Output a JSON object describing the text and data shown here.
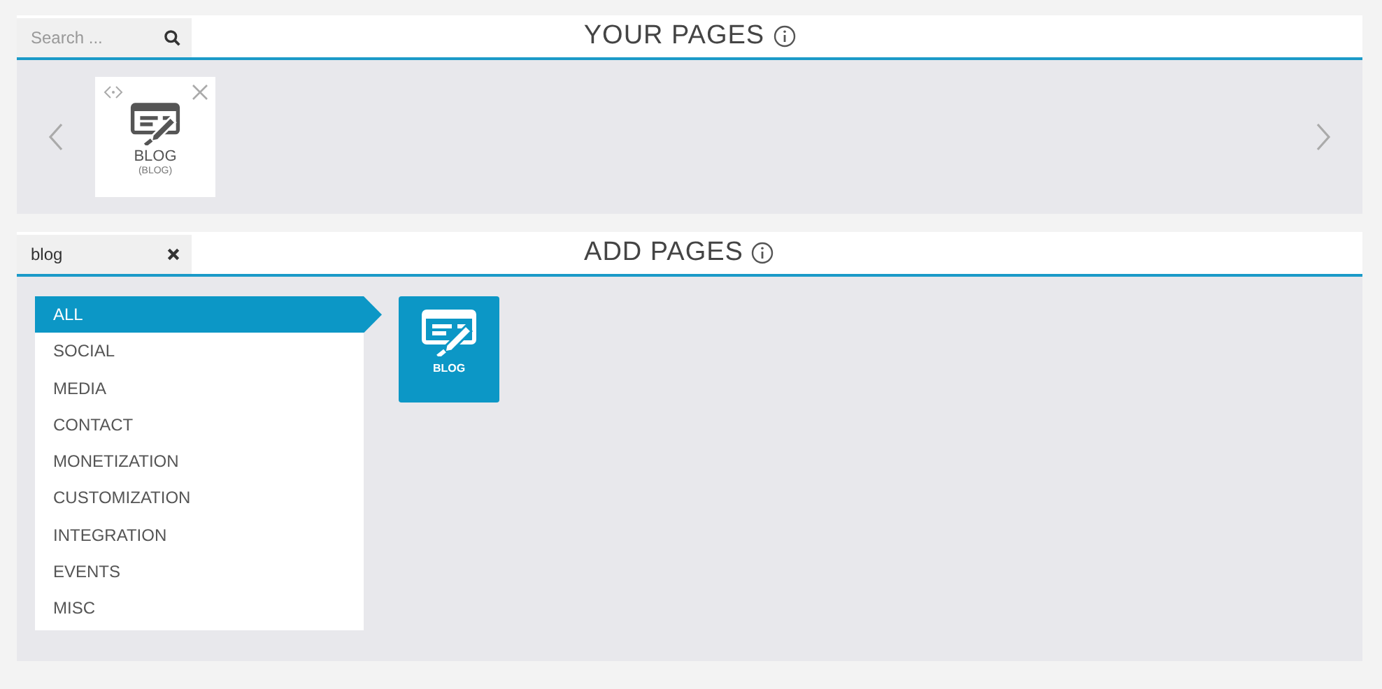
{
  "your_pages": {
    "search": {
      "placeholder": "Search ..."
    },
    "title": "YOUR PAGES",
    "pages": [
      {
        "label": "BLOG",
        "sublabel": "(BLOG)"
      }
    ]
  },
  "add_pages": {
    "search": {
      "value": "blog"
    },
    "title": "ADD PAGES",
    "categories": [
      {
        "label": "ALL",
        "selected": true
      },
      {
        "label": "SOCIAL",
        "selected": false
      },
      {
        "label": "MEDIA",
        "selected": false
      },
      {
        "label": "CONTACT",
        "selected": false
      },
      {
        "label": "MONETIZATION",
        "selected": false
      },
      {
        "label": "CUSTOMIZATION",
        "selected": false
      },
      {
        "label": "INTEGRATION",
        "selected": false
      },
      {
        "label": "EVENTS",
        "selected": false
      },
      {
        "label": "MISC",
        "selected": false
      }
    ],
    "results": [
      {
        "label": "BLOG"
      }
    ]
  }
}
